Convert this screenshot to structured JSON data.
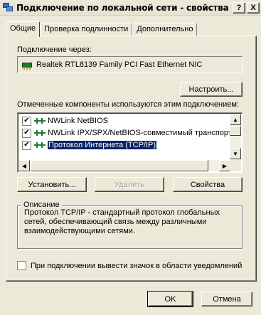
{
  "window": {
    "title": "Подключение по локальной сети - свойства",
    "help_btn": "?",
    "close_btn": "X"
  },
  "tabs": [
    {
      "label": "Общие",
      "active": true
    },
    {
      "label": "Проверка подлинности",
      "active": false
    },
    {
      "label": "Дополнительно",
      "active": false
    }
  ],
  "connect_via": {
    "label": "Подключение через:",
    "adapter": "Realtek RTL8139 Family PCI Fast Ethernet NIC",
    "configure_btn": "Настроить..."
  },
  "components": {
    "label": "Отмеченные компоненты используются этим подключением:",
    "items": [
      {
        "label": "NWLink NetBIOS",
        "checked": true,
        "selected": false
      },
      {
        "label": "NWLink IPX/SPX/NetBIOS-совместимый транспорт",
        "checked": true,
        "selected": false
      },
      {
        "label": "Протокол Интернета (TCP/IP)",
        "checked": true,
        "selected": true
      }
    ],
    "check_mark": "✔",
    "scroll_up": "▲",
    "scroll_down": "▼",
    "scroll_left": "◀",
    "scroll_right": "▶"
  },
  "actions": {
    "install": "Установить...",
    "remove": "Удалить",
    "properties": "Свойства"
  },
  "description": {
    "title": "Описание",
    "text": "Протокол TCP/IP - стандартный протокол глобальных сетей, обеспечивающий связь между различными взаимодействующими сетями."
  },
  "notify": {
    "label": "При подключении вывести значок в области уведомлений",
    "checked": false
  },
  "footer": {
    "ok": "OK",
    "cancel": "Отмена"
  }
}
